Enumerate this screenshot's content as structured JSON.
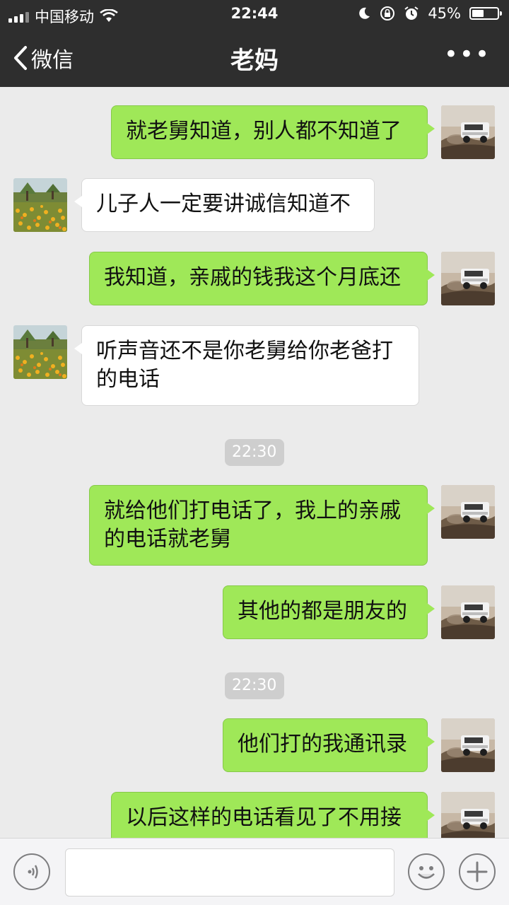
{
  "status": {
    "carrier": "中国移动",
    "time": "22:44",
    "battery": "45%"
  },
  "nav": {
    "back_label": "微信",
    "title": "老妈",
    "more": "•••"
  },
  "messages": [
    {
      "side": "me",
      "text": "就老舅知道，别人都不知道了"
    },
    {
      "side": "other",
      "text": "儿子人一定要讲诚信知道不"
    },
    {
      "side": "me",
      "text": "我知道，亲戚的钱我这个月底还"
    },
    {
      "side": "other",
      "text_lines": [
        "听声音还不是你老舅给你老爸打",
        "的电话"
      ]
    },
    {
      "type": "time",
      "text": "22:30"
    },
    {
      "side": "me",
      "text_lines": [
        "就给他们打电话了，我上的亲戚",
        "的电话就老舅"
      ]
    },
    {
      "side": "me",
      "text": "其他的都是朋友的"
    },
    {
      "type": "time",
      "text": "22:30"
    },
    {
      "side": "me",
      "text": "他们打的我通讯录"
    },
    {
      "side": "me",
      "text": "以后这样的电话看见了不用接"
    }
  ],
  "icons": {
    "voice": "voice-icon",
    "emoji": "emoji-icon",
    "add": "plus-icon"
  },
  "colors": {
    "nav_bg": "#2e2e2e",
    "chat_bg": "#ebebeb",
    "my_bubble": "#9fe858",
    "other_bubble": "#ffffff"
  }
}
